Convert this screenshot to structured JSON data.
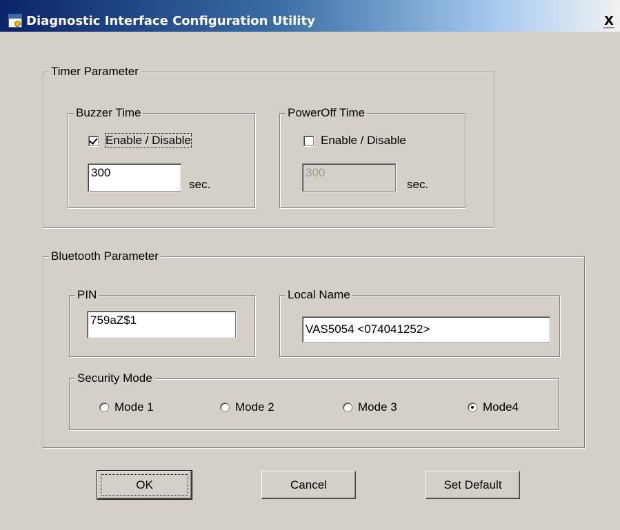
{
  "window": {
    "title": "Diagnostic Interface Configuration Utility",
    "close_glyph": "X"
  },
  "timer": {
    "legend": "Timer Parameter",
    "buzzer": {
      "legend": "Buzzer Time",
      "enable_label": "Enable / Disable",
      "enabled": true,
      "value": "300",
      "unit": "sec."
    },
    "poweroff": {
      "legend": "PowerOff Time",
      "enable_label": "Enable / Disable",
      "enabled": false,
      "value": "300",
      "unit": "sec."
    }
  },
  "bluetooth": {
    "legend": "Bluetooth Parameter",
    "pin": {
      "legend": "PIN",
      "value": "759aZ$1"
    },
    "local_name": {
      "legend": "Local Name",
      "value": "VAS5054 <074041252>"
    },
    "security": {
      "legend": "Security Mode",
      "modes": [
        {
          "label": "Mode 1",
          "selected": false
        },
        {
          "label": "Mode 2",
          "selected": false
        },
        {
          "label": "Mode 3",
          "selected": false
        },
        {
          "label": "Mode4",
          "selected": true
        }
      ]
    }
  },
  "buttons": {
    "ok": "OK",
    "cancel": "Cancel",
    "set_default": "Set Default"
  },
  "colors": {
    "dialog_bg": "#d4d0c8",
    "title_gradient_start": "#0a246a",
    "title_gradient_end": "#a6caf0"
  }
}
